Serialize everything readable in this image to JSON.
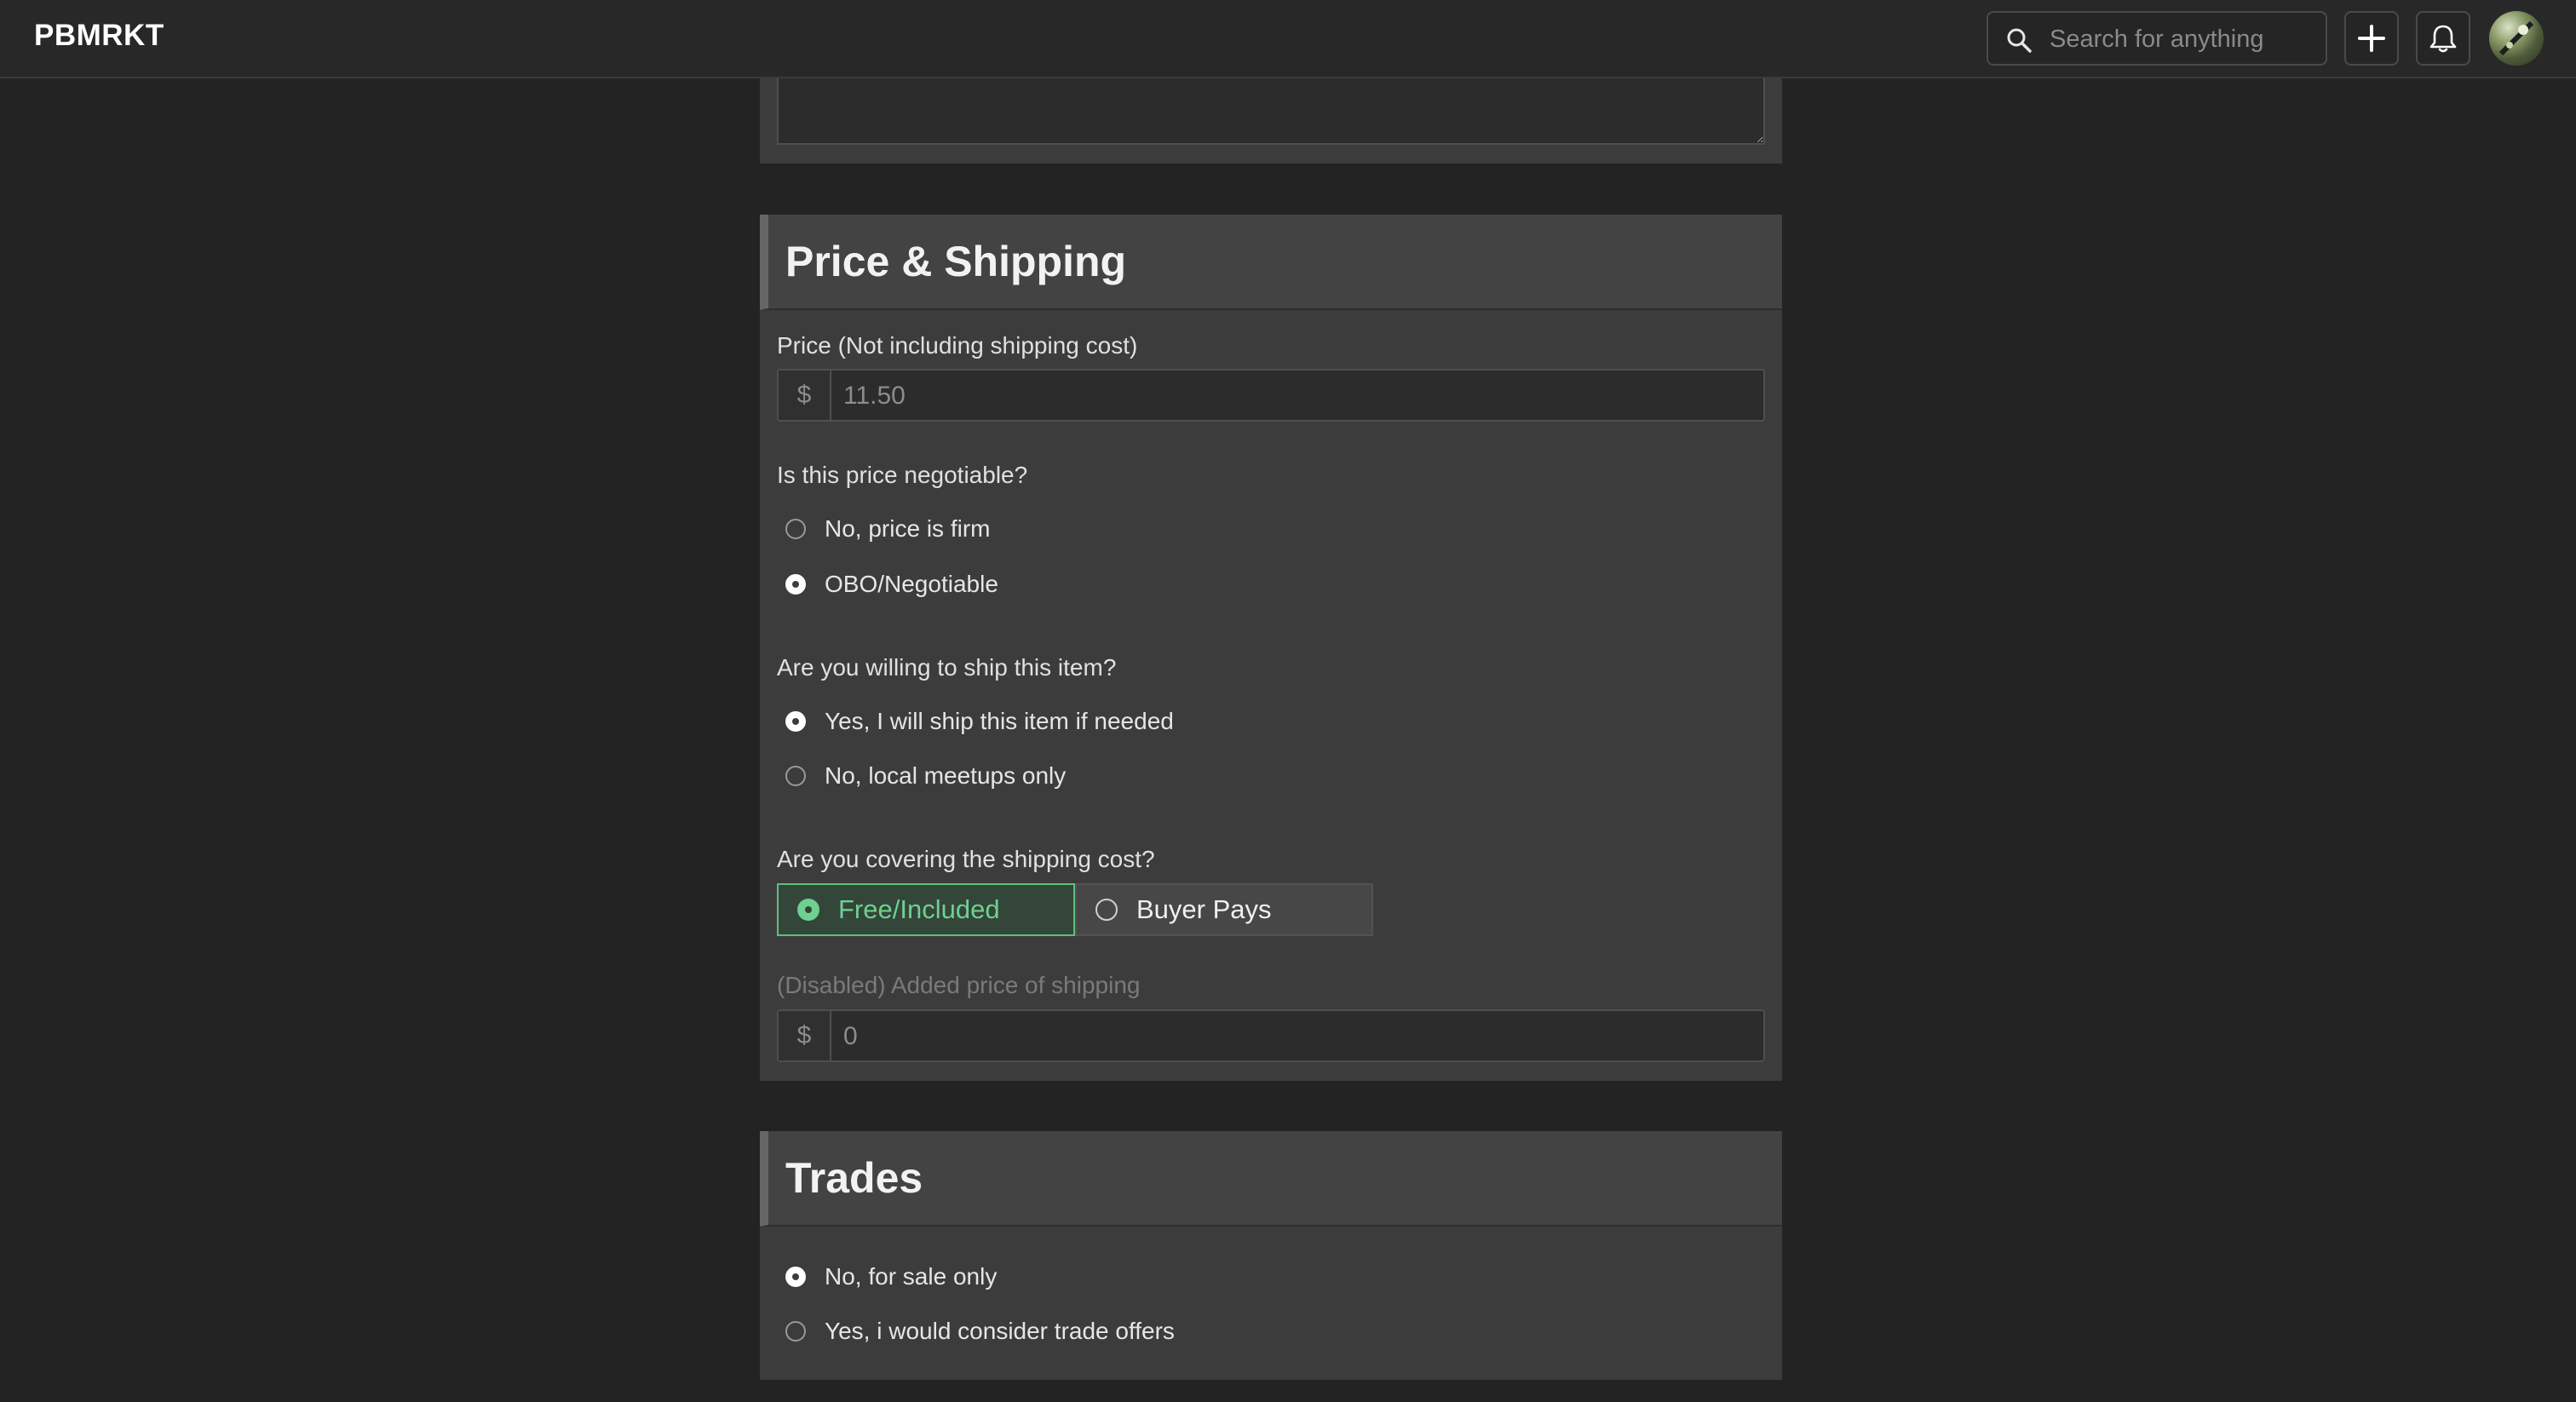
{
  "app": {
    "brand": "PBMRKT"
  },
  "header": {
    "search_placeholder": "Search for anything"
  },
  "price_section": {
    "title": "Price & Shipping",
    "price_label": "Price (Not including shipping cost)",
    "currency_symbol": "$",
    "price_placeholder": "11.50",
    "negotiable_question": "Is this price negotiable?",
    "negotiable_options": [
      "No, price is firm",
      "OBO/Negotiable"
    ],
    "negotiable_selected": "OBO/Negotiable",
    "ship_question": "Are you willing to ship this item?",
    "ship_options": [
      "Yes, I will ship this item if needed",
      "No, local meetups only"
    ],
    "ship_selected": "Yes, I will ship this item if needed",
    "shipping_cost_question": "Are you covering the shipping cost?",
    "shipping_cost_options": [
      "Free/Included",
      "Buyer Pays"
    ],
    "shipping_cost_selected": "Free/Included",
    "added_shipping_label": "(Disabled) Added price of shipping",
    "added_shipping_placeholder": "0"
  },
  "trades_section": {
    "title": "Trades",
    "options": [
      "No, for sale only",
      "Yes, i would consider trade offers"
    ],
    "selected": "No, for sale only"
  },
  "colors": {
    "accent_green": "#6fd08f",
    "background": "#232323",
    "card": "#3c3c3c"
  }
}
